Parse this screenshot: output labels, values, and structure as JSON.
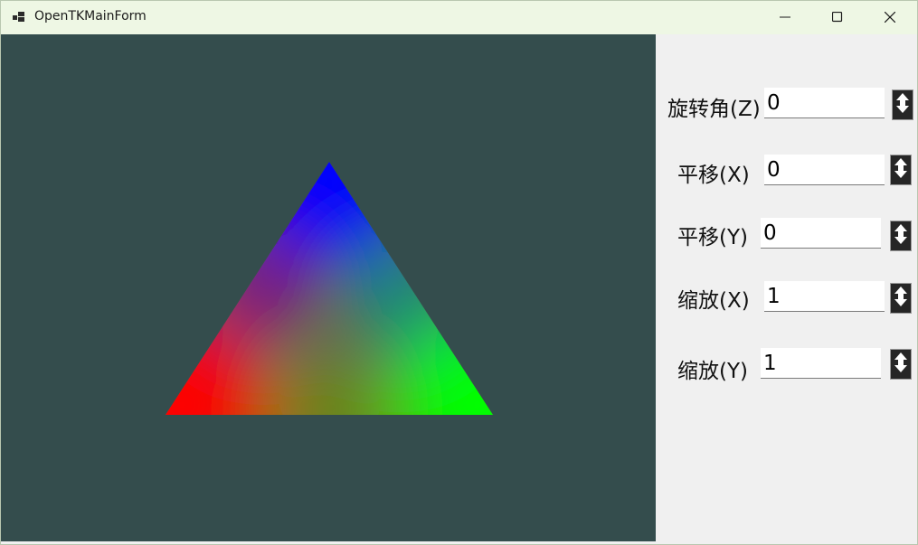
{
  "window": {
    "title": "OpenTKMainForm",
    "app_icon": "windows-form-icon",
    "controls": [
      "minimize-icon",
      "maximize-icon",
      "close-icon"
    ]
  },
  "viewport": {
    "background": "#344d4d",
    "triangle": {
      "top_color": "#0000ff",
      "left_color": "#ff0000",
      "right_color": "#00ff00"
    }
  },
  "controls": [
    {
      "label": "旋转角(Z)",
      "value": "0"
    },
    {
      "label": "平移(X)",
      "value": "0"
    },
    {
      "label": "平移(Y)",
      "value": "0"
    },
    {
      "label": "缩放(X)",
      "value": "1"
    },
    {
      "label": "缩放(Y)",
      "value": "1"
    }
  ],
  "spinner_icon": "up-down-arrows-icon"
}
